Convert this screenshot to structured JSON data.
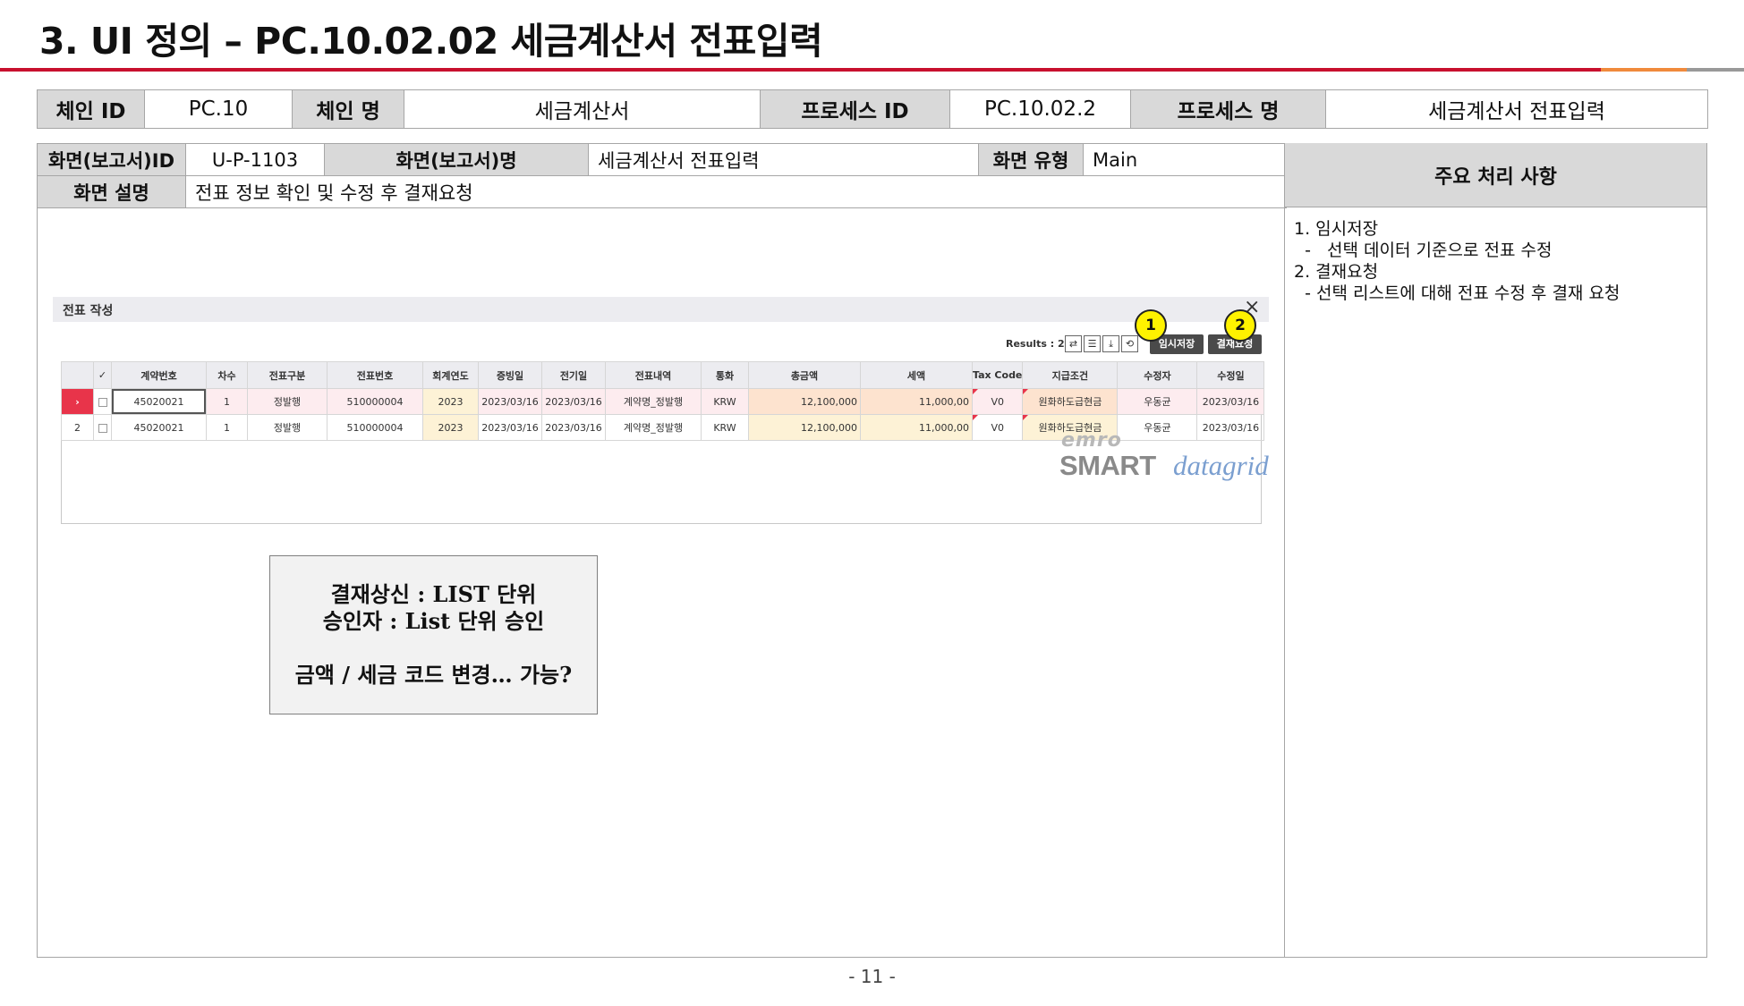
{
  "title": "3. UI 정의 – PC.10.02.02 세금계산서 전표입력",
  "meta_row1": {
    "chain_id_label": "체인 ID",
    "chain_id": "PC.10",
    "chain_name_label": "체인 명",
    "chain_name": "세금계산서",
    "process_id_label": "프로세스 ID",
    "process_id": "PC.10.02.2",
    "process_name_label": "프로세스 명",
    "process_name": "세금계산서 전표입력"
  },
  "meta_row2": {
    "screen_id_label": "화면(보고서)ID",
    "screen_id": "U-P-1103",
    "screen_name_label": "화면(보고서)명",
    "screen_name": "세금계산서 전표입력",
    "screen_type_label": "화면 유형",
    "screen_type": "Main",
    "screen_desc_label": "화면 설명",
    "screen_desc": "전표 정보 확인 및 수정 후 결재요청"
  },
  "side": {
    "header": "주요 처리 사항",
    "lines": [
      "1. 임시저장",
      "  -   선택 데이터 기준으로 전표 수정",
      "",
      "2. 결재요청",
      "  - 선택 리스트에 대해 전표 수정 후 결재 요청"
    ]
  },
  "panel": {
    "title": "전표 작성",
    "close_icon": "×",
    "results": "Results : 2",
    "temp_save": "임시저장",
    "approval_request": "결재요청",
    "badge1": "1",
    "badge2": "2"
  },
  "grid": {
    "columns": [
      "계약번호",
      "차수",
      "전표구분",
      "전표번호",
      "회계연도",
      "증빙일",
      "전기일",
      "전표내역",
      "통화",
      "총금액",
      "세액",
      "Tax Code",
      "지급조건",
      "수정자",
      "수정일"
    ],
    "rows": [
      {
        "no": "›",
        "cells": [
          "45020021",
          "1",
          "정발행",
          "510000004",
          "2023",
          "2023/03/16",
          "2023/03/16",
          "계약명_정발행",
          "KRW",
          "12,100,000",
          "11,000,00",
          "V0",
          "원화하도급현금",
          "우동균",
          "2023/03/16"
        ]
      },
      {
        "no": "2",
        "cells": [
          "45020021",
          "1",
          "정발행",
          "510000004",
          "2023",
          "2023/03/16",
          "2023/03/16",
          "계약명_정발행",
          "KRW",
          "12,100,000",
          "11,000,00",
          "V0",
          "원화하도급현금",
          "우동균",
          "2023/03/16"
        ]
      }
    ]
  },
  "logo": {
    "emro": "emro",
    "smart": "SMART",
    "datagrid": "datagrid"
  },
  "note": {
    "lines": [
      "결재상신 : LIST 단위",
      "승인자 : List 단위 승인",
      "",
      "금액 / 세금 코드 변경… 가능?"
    ]
  },
  "page_number": "- 11 -",
  "colors": {
    "brand_red": "#c8102e",
    "accent_orange": "#f08a3c",
    "header_grey": "#d9d9d9",
    "badge_yellow": "#fff200"
  }
}
